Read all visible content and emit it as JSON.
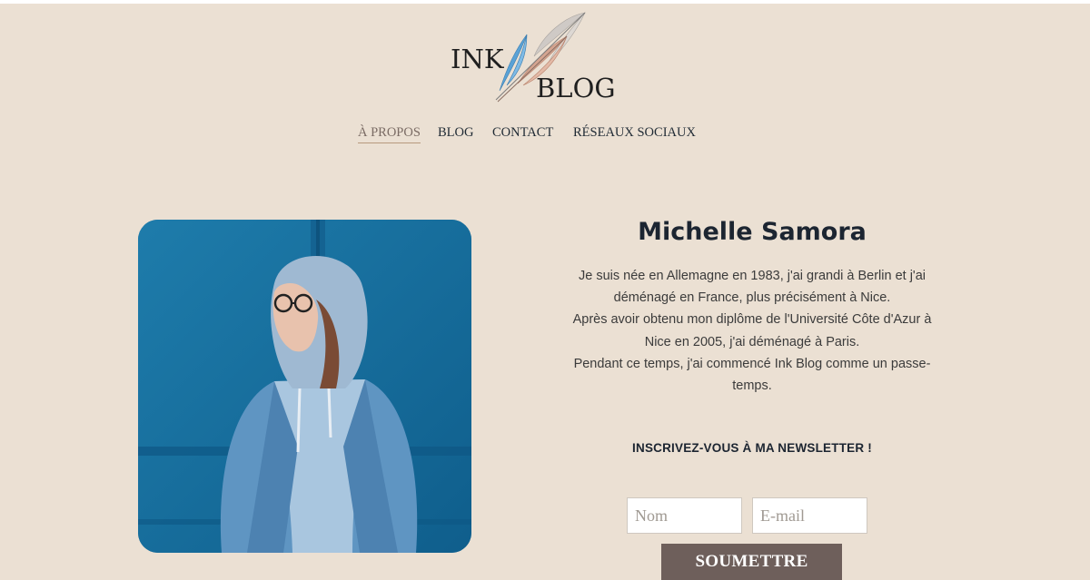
{
  "logo": {
    "word1": "INK",
    "word2": "BLOG"
  },
  "nav": {
    "items": [
      {
        "label": "À PROPOS",
        "active": true
      },
      {
        "label": "BLOG",
        "active": false
      },
      {
        "label": "CONTACT",
        "active": false
      },
      {
        "label": "RÉSEAUX SOCIAUX",
        "active": false
      }
    ]
  },
  "profile": {
    "name": "Michelle Samora",
    "bio_lines": [
      "Je suis née en Allemagne en 1983, j'ai grandi à Berlin et j'ai",
      "déménagé en France, plus précisément à Nice.",
      "Après avoir obtenu mon diplôme de l'Université Côte d'Azur à",
      "Nice en 2005, j'ai déménagé à Paris.",
      "Pendant ce temps, j'ai commencé Ink Blog comme un passe-",
      "temps."
    ]
  },
  "newsletter": {
    "title": "INSCRIVEZ-VOUS À MA NEWSLETTER !",
    "name_placeholder": "Nom",
    "email_placeholder": "E-mail",
    "submit_label": "SOUMETTRE"
  },
  "colors": {
    "background": "#ebe0d3",
    "heading": "#1c2531",
    "button": "#6e5f5b",
    "nav_active": "#7a6b64"
  }
}
